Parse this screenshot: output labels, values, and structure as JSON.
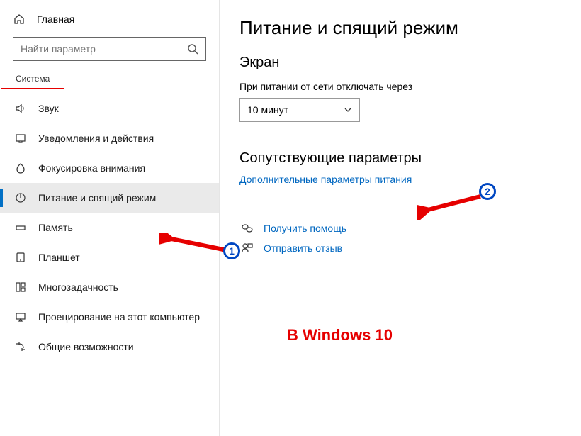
{
  "sidebar": {
    "home": "Главная",
    "search_placeholder": "Найти параметр",
    "section": "Система",
    "items": [
      {
        "label": "Звук"
      },
      {
        "label": "Уведомления и действия"
      },
      {
        "label": "Фокусировка внимания"
      },
      {
        "label": "Питание и спящий режим"
      },
      {
        "label": "Память"
      },
      {
        "label": "Планшет"
      },
      {
        "label": "Многозадачность"
      },
      {
        "label": "Проецирование на этот компьютер"
      },
      {
        "label": "Общие возможности"
      }
    ]
  },
  "main": {
    "title": "Питание и спящий режим",
    "screen_heading": "Экран",
    "screen_off_label": "При питании от сети отключать через",
    "screen_off_value": "10 минут",
    "related_heading": "Сопутствующие параметры",
    "extra_power_link": "Дополнительные параметры питания",
    "get_help": "Получить помощь",
    "feedback": "Отправить отзыв"
  },
  "annotations": {
    "text": "В Windows 10",
    "badge1": "1",
    "badge2": "2"
  }
}
